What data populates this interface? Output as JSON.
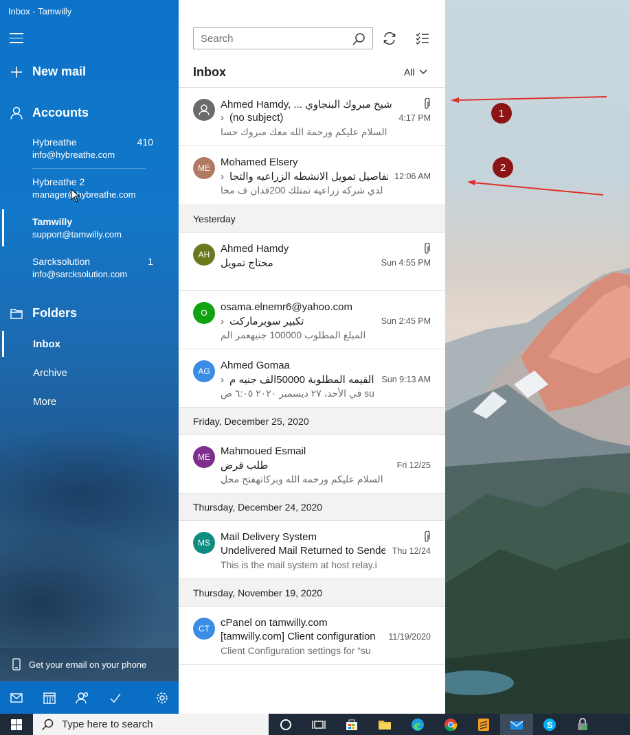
{
  "window": {
    "title": "Inbox - Tamwilly"
  },
  "sidebar": {
    "new_mail": "New mail",
    "accounts_label": "Accounts",
    "accounts": [
      {
        "name": "Hybreathe",
        "email": "info@hybreathe.com",
        "count": "410"
      },
      {
        "name": "Hybreathe 2",
        "email": "manager@hybreathe.com",
        "count": ""
      },
      {
        "name": "Tamwilly",
        "email": "support@tamwilly.com",
        "count": ""
      },
      {
        "name": "Sarcksolution",
        "email": "info@sarcksolution.com",
        "count": "1"
      }
    ],
    "folders_label": "Folders",
    "folders": [
      "Inbox",
      "Archive",
      "More"
    ],
    "phone_promo": "Get your email on your phone"
  },
  "list": {
    "search_placeholder": "Search",
    "title": "Inbox",
    "filter": "All",
    "messages_today": [
      {
        "initials": "",
        "from": "Ahmed Hamdy, ... شيخ مبروك البنجاوي,",
        "subject": "(no subject)",
        "preview": "السلام عليكم ورحمة الله معك مبروك حسا",
        "time": "4:17 PM",
        "attachment": true,
        "color": "#6b6b6b"
      },
      {
        "initials": "ME",
        "from": "Mohamed Elsery",
        "subject": "تفاصيل تمويل الانشطه الزراعيه والتجا",
        "preview": "لدي شركه زراعيه تمتلك 200فدان ف محا",
        "time": "12:06 AM",
        "attachment": false,
        "color": "#b07a63"
      }
    ],
    "group_yesterday": "Yesterday",
    "messages_yesterday": [
      {
        "initials": "AH",
        "from": "Ahmed Hamdy",
        "subject": "محتاج تمويل",
        "preview": "",
        "time": "Sun 4:55 PM",
        "attachment": true,
        "color": "#6b7a1e"
      },
      {
        "initials": "O",
        "from": "osama.elnemr6@yahoo.com",
        "subject": "تكبير سوبرماركت",
        "preview": "المبلغ المطلوب 100000 جنيهعمر الم",
        "time": "Sun 2:45 PM",
        "attachment": false,
        "color": "#10a310"
      },
      {
        "initials": "AG",
        "from": "Ahmed Gomaa",
        "subject": "القيمه المطلوبة 50000الف جنيه م",
        "preview": "في الأحد، ٢٧ ديسمبر ٢٠٢٠ ٦:٠٥ ص su",
        "time": "Sun 9:13 AM",
        "attachment": false,
        "color": "#3a8ce4"
      }
    ],
    "group_dec25": "Friday, December 25, 2020",
    "messages_dec25": [
      {
        "initials": "ME",
        "from": "Mahmoued Esmail",
        "subject": "طلب قرض",
        "preview": "السلام عليكم ورحمه الله وبركاتهفتح محل",
        "time": "Fri 12/25",
        "attachment": false,
        "color": "#7e2f8e"
      }
    ],
    "group_dec24": "Thursday, December 24, 2020",
    "messages_dec24": [
      {
        "initials": "MS",
        "from": "Mail Delivery System",
        "subject": "Undelivered Mail Returned to Sende",
        "preview": "This is the mail system at host relay.i",
        "time": "Thu 12/24",
        "attachment": true,
        "color": "#0f8c80"
      }
    ],
    "group_nov19": "Thursday, November 19, 2020",
    "messages_nov19": [
      {
        "initials": "CT",
        "from": "cPanel on tamwilly.com",
        "subject": "[tamwilly.com] Client configuration",
        "preview": "Client Configuration settings for “su",
        "time": "11/19/2020",
        "attachment": false,
        "color": "#3a8ce4"
      }
    ]
  },
  "annotations": {
    "marker1": "1",
    "marker2": "2",
    "marker_color": "#8b1414"
  },
  "taskbar": {
    "search_text": "Type here to search"
  }
}
